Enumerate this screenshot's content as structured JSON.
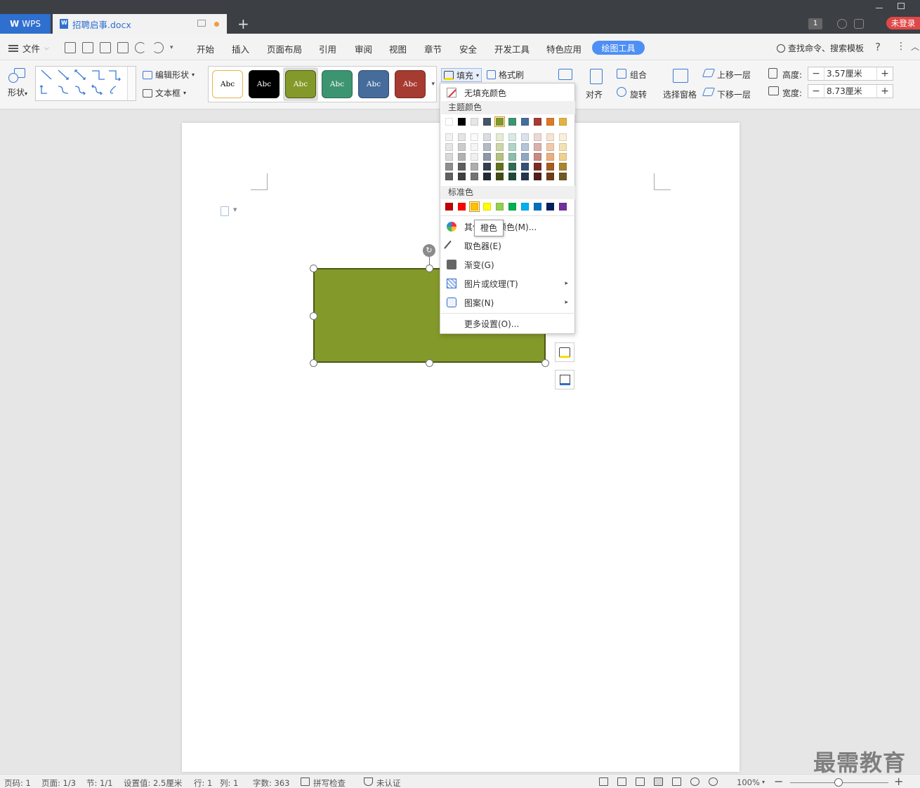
{
  "titlebar": {
    "app_tab": "WPS",
    "doc_tab": "招聘启事.docx",
    "new_tab": "+",
    "badge": "1",
    "login": "未登录"
  },
  "menubar": {
    "file": "文件",
    "items": [
      "开始",
      "插入",
      "页面布局",
      "引用",
      "审阅",
      "视图",
      "章节",
      "安全",
      "开发工具",
      "特色应用"
    ],
    "active": "绘图工具",
    "search": "查找命令、搜索模板",
    "help": "?"
  },
  "ribbon": {
    "shape": "形状",
    "edit_shape": "编辑形状",
    "textbox": "文本框",
    "style_label": "Abc",
    "style_colors": [
      {
        "bg": "#ffffff",
        "fg": "#000000",
        "border": "#e8b44a"
      },
      {
        "bg": "#000000",
        "fg": "#ffffff",
        "border": "#000000"
      },
      {
        "bg": "#83992a",
        "fg": "#ffffff",
        "border": "#4a5a14"
      },
      {
        "bg": "#3d9471",
        "fg": "#ffffff",
        "border": "#2a6a50"
      },
      {
        "bg": "#466c9c",
        "fg": "#ffffff",
        "border": "#2e4a70"
      },
      {
        "bg": "#a63b31",
        "fg": "#ffffff",
        "border": "#742820"
      }
    ],
    "fill": "填充",
    "format_brush": "格式刷",
    "align": "对齐",
    "group": "组合",
    "rotate": "旋转",
    "selection_pane": "选择窗格",
    "bring_forward": "上移一层",
    "send_backward": "下移一层",
    "height_label": "高度:",
    "height_value": "3.57厘米",
    "width_label": "宽度:",
    "width_value": "8.73厘米"
  },
  "fill_menu": {
    "no_fill": "无填充颜色",
    "theme_colors": "主题颜色",
    "theme_top": [
      "#ffffff",
      "#000000",
      "#e7e6e6",
      "#44546a",
      "#83992a",
      "#3d9471",
      "#466c9c",
      "#a63b31",
      "#dd7a2a",
      "#e2b343"
    ],
    "standard_colors": "标准色",
    "standard": [
      "#c00000",
      "#ff0000",
      "#ffc000",
      "#ffff00",
      "#92d050",
      "#00b050",
      "#00b0f0",
      "#0070c0",
      "#002060",
      "#7030a0"
    ],
    "more_colors": "其他填充颜色(M)...",
    "eyedropper": "取色器(E)",
    "gradient": "渐变(G)",
    "picture_texture": "图片或纹理(T)",
    "pattern": "图案(N)",
    "more_settings": "更多设置(O)...",
    "tooltip": "橙色"
  },
  "statusbar": {
    "page_no": "页码: 1",
    "pages": "页面: 1/3",
    "section": "节: 1/1",
    "setting": "设置值: 2.5厘米",
    "row": "行: 1",
    "col": "列: 1",
    "words": "字数: 363",
    "spell": "拼写检查",
    "cert": "未认证",
    "zoom": "100%"
  },
  "watermark": "最需教育"
}
